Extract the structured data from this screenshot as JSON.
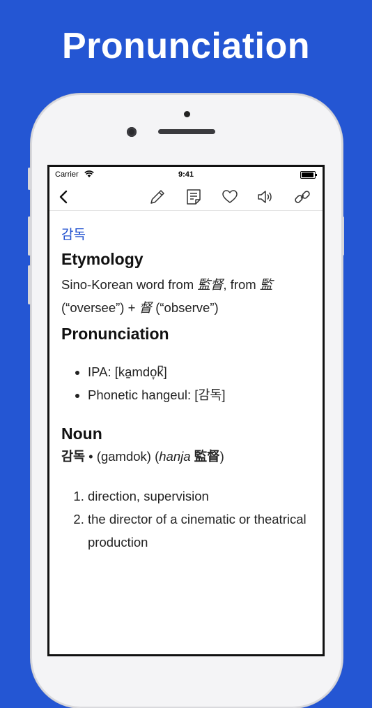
{
  "headline": "Pronunciation",
  "status": {
    "carrier": "Carrier",
    "time": "9:41"
  },
  "toolbar": {
    "back": "back",
    "icons": [
      "pencil-icon",
      "note-icon",
      "heart-icon",
      "speaker-icon",
      "link-icon"
    ]
  },
  "entry": {
    "word": "감독",
    "etymology_heading": "Etymology",
    "etymology_text_1": "Sino-Korean word from ",
    "etymology_hanja_1": "監督",
    "etymology_text_2": ", from ",
    "etymology_hanja_2": "監",
    "etymology_text_3": "(“oversee”) + ",
    "etymology_hanja_3": "督",
    "etymology_text_4": " (“observe”)",
    "pronunciation_heading": "Pronunciation",
    "pronunciation_items": [
      "IPA: [ka̠mdo̞k̚]",
      "Phonetic hangeul: [감독]"
    ],
    "noun_heading": "Noun",
    "noun_word": "감독",
    "noun_sep": " • (gamdok) (",
    "noun_hanja_label": "hanja",
    "noun_hanja": "監督",
    "noun_close": ")",
    "definitions": [
      "direction, supervision",
      "the director of a cinematic or theatrical production"
    ]
  },
  "colors": {
    "background": "#2456d3",
    "link": "#1f4fcf"
  }
}
